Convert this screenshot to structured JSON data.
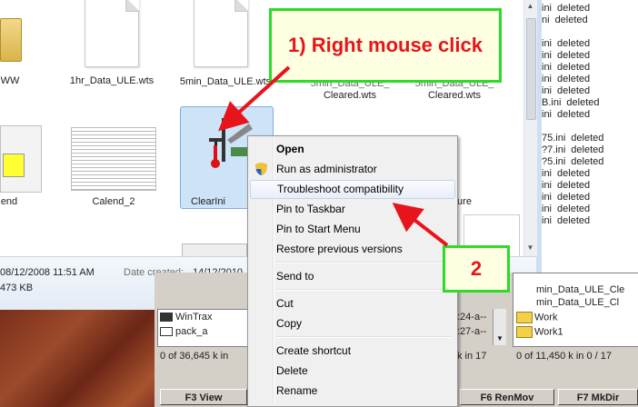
{
  "explorer": {
    "files": [
      {
        "name": "WW"
      },
      {
        "name": "1hr_Data_ULE.wts"
      },
      {
        "name": "5min_Data_ULE.wts"
      },
      {
        "name": "Cleared.wts",
        "partial_top": "5min_Data_ULE_"
      },
      {
        "name": "Cleared.wts",
        "partial_top": "5min_Data_ULE_"
      },
      {
        "name": "end"
      },
      {
        "name": "Calend_2"
      },
      {
        "name": "ClearIni"
      },
      {
        "name": "ure"
      }
    ],
    "details": {
      "date_modified": "08/12/2008 11:51 AM",
      "date_created_label": "Date created:",
      "date_created": "14/12/2010",
      "size": "473 KB"
    }
  },
  "log": {
    "lines": [
      {
        "name": "ini",
        "status": "deleted"
      },
      {
        "name": "ni",
        "status": "deleted"
      },
      {
        "name": "",
        "status": ""
      },
      {
        "name": "ini",
        "status": "deleted"
      },
      {
        "name": "ini",
        "status": "deleted"
      },
      {
        "name": "ini",
        "status": "deleted"
      },
      {
        "name": "ini",
        "status": "deleted"
      },
      {
        "name": "ini",
        "status": "deleted"
      },
      {
        "name": "B.ini",
        "status": "deleted"
      },
      {
        "name": "ini",
        "status": "deleted"
      },
      {
        "name": "",
        "status": ""
      },
      {
        "name": "75.ini",
        "status": "deleted"
      },
      {
        "name": "?7.ini",
        "status": "deleted"
      },
      {
        "name": "?5.ini",
        "status": "deleted"
      },
      {
        "name": "ini",
        "status": "deleted"
      },
      {
        "name": "ini",
        "status": "deleted"
      },
      {
        "name": "ini",
        "status": "deleted"
      },
      {
        "name": "ini",
        "status": "deleted"
      },
      {
        "name": "ini",
        "status": "deleted"
      }
    ]
  },
  "total_commander": {
    "left_rows": [
      "WinTrax",
      "pack_a"
    ],
    "left_status": "0 of 36,645 k in",
    "mid_rows": [
      ":24-a--",
      ":27-a--"
    ],
    "mid_status": "k in 17",
    "right_rows": [
      "min_Data_ULE_Cle",
      "min_Data_ULE_Cl",
      "Work",
      "Work1"
    ],
    "right_status": "0 of 11,450 k in 0 / 17",
    "buttons": [
      "F3 View",
      "F6 RenMov",
      "F7 MkDir"
    ]
  },
  "context_menu": {
    "items": [
      {
        "label": "Open",
        "bold": true
      },
      {
        "label": "Run as administrator",
        "icon": "uac-shield-icon"
      },
      {
        "label": "Troubleshoot compatibility",
        "hover": true
      },
      {
        "label": "Pin to Taskbar"
      },
      {
        "label": "Pin to Start Menu"
      },
      {
        "label": "Restore previous versions"
      },
      {
        "label": "Send to"
      },
      {
        "label": "Cut"
      },
      {
        "label": "Copy"
      },
      {
        "label": "Create shortcut"
      },
      {
        "label": "Delete"
      },
      {
        "label": "Rename"
      }
    ]
  },
  "callouts": {
    "step1": "1) Right mouse click",
    "step2": "2"
  },
  "colors": {
    "callout_border": "#2bdc2b",
    "callout_text": "#e8141b",
    "callout_bg": "#ffffe1",
    "arrow": "#e8141b",
    "selection": "#cde3f7"
  }
}
